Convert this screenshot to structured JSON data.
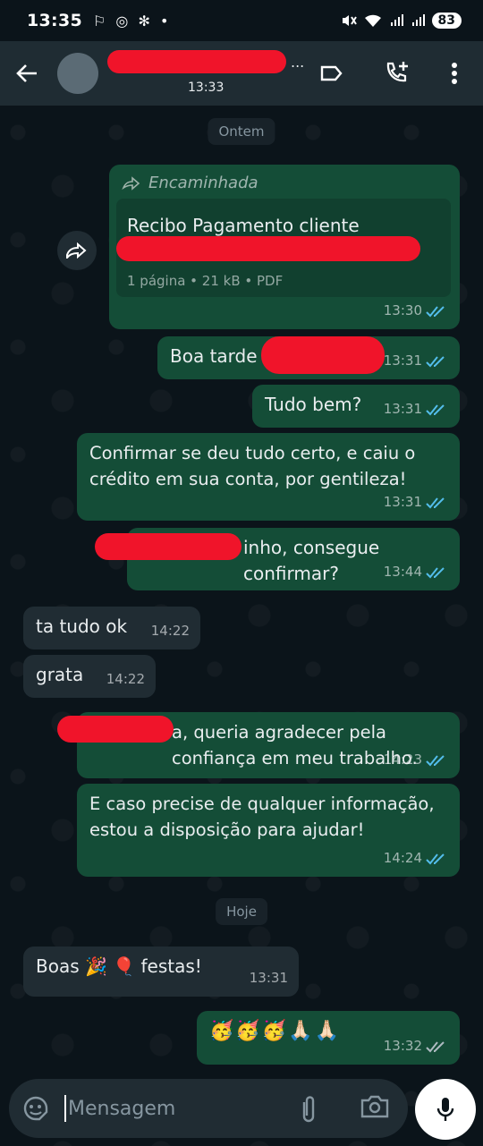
{
  "status_bar": {
    "time": "13:35",
    "left_icons": "⚐ ◎ ✻ •",
    "battery": "83"
  },
  "header": {
    "contact_tail": "...",
    "last_seen": "13:33"
  },
  "chat": {
    "date_yesterday": "Ontem",
    "date_today": "Hoje",
    "forwarded": {
      "label": "Encaminhada",
      "doc_title": "Recibo Pagamento cliente",
      "doc_info": "1 página • 21 kB • PDF",
      "time": "13:30"
    },
    "messages": [
      {
        "text": "Boa tarde",
        "time": "13:31"
      },
      {
        "text": "Tudo bem?",
        "time": "13:31"
      },
      {
        "text": "Confirmar se deu tudo certo, e caiu o crédito em sua conta, por gentileza!",
        "time": "13:31"
      },
      {
        "text": "inho, consegue confirmar?",
        "time": "13:44"
      },
      {
        "text": "ta tudo ok",
        "time": "14:22"
      },
      {
        "text": "grata",
        "time": "14:22"
      },
      {
        "text": "a, queria agradecer pela confiança em meu trabalho.",
        "time": "14:23"
      },
      {
        "text": "E caso precise de qualquer informação, estou a disposição para ajudar!",
        "time": "14:24"
      },
      {
        "text": "Boas 🎉 🎈 festas!",
        "time": "13:31"
      },
      {
        "text": "🥳🥳🥳🙏🏻🙏🏻",
        "time": "13:32"
      }
    ]
  },
  "composer": {
    "placeholder": "Mensagem"
  },
  "colors": {
    "outgoing_bubble": "#144d37",
    "incoming_bubble": "#202c33",
    "background": "#0b141a",
    "read_ticks": "#53bdeb"
  },
  "icons": [
    "back-arrow-icon",
    "label-icon",
    "add-call-icon",
    "more-vert-icon",
    "forward-icon",
    "sticker-icon",
    "attach-icon",
    "camera-icon",
    "mic-icon"
  ]
}
